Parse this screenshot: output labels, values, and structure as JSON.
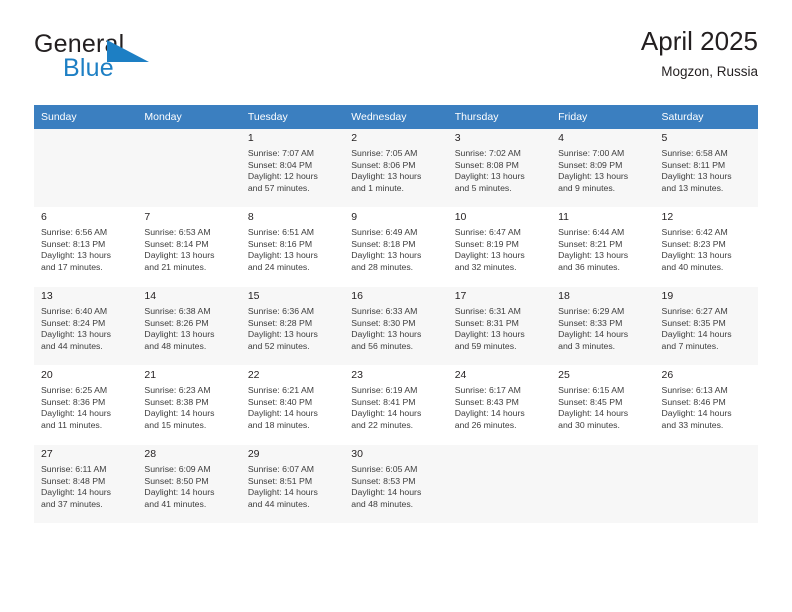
{
  "logo": {
    "word_one": "General",
    "word_two": "Blue",
    "triangle_color": "#1d7fc4",
    "icon": "triangle-flag-icon"
  },
  "header": {
    "title": "April 2025",
    "subtitle": "Mogzon, Russia",
    "accent_color": "#3b7fc0"
  },
  "calendar": {
    "weekdays": [
      "Sunday",
      "Monday",
      "Tuesday",
      "Wednesday",
      "Thursday",
      "Friday",
      "Saturday"
    ],
    "labels": {
      "sunrise": "Sunrise:",
      "sunset": "Sunset:",
      "daylight": "Daylight:"
    },
    "weeks": [
      [
        {
          "day": "",
          "sunrise": "",
          "sunset": "",
          "daylight_line1": "",
          "daylight_line2": ""
        },
        {
          "day": "",
          "sunrise": "",
          "sunset": "",
          "daylight_line1": "",
          "daylight_line2": ""
        },
        {
          "day": "1",
          "sunrise": "Sunrise: 7:07 AM",
          "sunset": "Sunset: 8:04 PM",
          "daylight_line1": "Daylight: 12 hours",
          "daylight_line2": "and 57 minutes."
        },
        {
          "day": "2",
          "sunrise": "Sunrise: 7:05 AM",
          "sunset": "Sunset: 8:06 PM",
          "daylight_line1": "Daylight: 13 hours",
          "daylight_line2": "and 1 minute."
        },
        {
          "day": "3",
          "sunrise": "Sunrise: 7:02 AM",
          "sunset": "Sunset: 8:08 PM",
          "daylight_line1": "Daylight: 13 hours",
          "daylight_line2": "and 5 minutes."
        },
        {
          "day": "4",
          "sunrise": "Sunrise: 7:00 AM",
          "sunset": "Sunset: 8:09 PM",
          "daylight_line1": "Daylight: 13 hours",
          "daylight_line2": "and 9 minutes."
        },
        {
          "day": "5",
          "sunrise": "Sunrise: 6:58 AM",
          "sunset": "Sunset: 8:11 PM",
          "daylight_line1": "Daylight: 13 hours",
          "daylight_line2": "and 13 minutes."
        }
      ],
      [
        {
          "day": "6",
          "sunrise": "Sunrise: 6:56 AM",
          "sunset": "Sunset: 8:13 PM",
          "daylight_line1": "Daylight: 13 hours",
          "daylight_line2": "and 17 minutes."
        },
        {
          "day": "7",
          "sunrise": "Sunrise: 6:53 AM",
          "sunset": "Sunset: 8:14 PM",
          "daylight_line1": "Daylight: 13 hours",
          "daylight_line2": "and 21 minutes."
        },
        {
          "day": "8",
          "sunrise": "Sunrise: 6:51 AM",
          "sunset": "Sunset: 8:16 PM",
          "daylight_line1": "Daylight: 13 hours",
          "daylight_line2": "and 24 minutes."
        },
        {
          "day": "9",
          "sunrise": "Sunrise: 6:49 AM",
          "sunset": "Sunset: 8:18 PM",
          "daylight_line1": "Daylight: 13 hours",
          "daylight_line2": "and 28 minutes."
        },
        {
          "day": "10",
          "sunrise": "Sunrise: 6:47 AM",
          "sunset": "Sunset: 8:19 PM",
          "daylight_line1": "Daylight: 13 hours",
          "daylight_line2": "and 32 minutes."
        },
        {
          "day": "11",
          "sunrise": "Sunrise: 6:44 AM",
          "sunset": "Sunset: 8:21 PM",
          "daylight_line1": "Daylight: 13 hours",
          "daylight_line2": "and 36 minutes."
        },
        {
          "day": "12",
          "sunrise": "Sunrise: 6:42 AM",
          "sunset": "Sunset: 8:23 PM",
          "daylight_line1": "Daylight: 13 hours",
          "daylight_line2": "and 40 minutes."
        }
      ],
      [
        {
          "day": "13",
          "sunrise": "Sunrise: 6:40 AM",
          "sunset": "Sunset: 8:24 PM",
          "daylight_line1": "Daylight: 13 hours",
          "daylight_line2": "and 44 minutes."
        },
        {
          "day": "14",
          "sunrise": "Sunrise: 6:38 AM",
          "sunset": "Sunset: 8:26 PM",
          "daylight_line1": "Daylight: 13 hours",
          "daylight_line2": "and 48 minutes."
        },
        {
          "day": "15",
          "sunrise": "Sunrise: 6:36 AM",
          "sunset": "Sunset: 8:28 PM",
          "daylight_line1": "Daylight: 13 hours",
          "daylight_line2": "and 52 minutes."
        },
        {
          "day": "16",
          "sunrise": "Sunrise: 6:33 AM",
          "sunset": "Sunset: 8:30 PM",
          "daylight_line1": "Daylight: 13 hours",
          "daylight_line2": "and 56 minutes."
        },
        {
          "day": "17",
          "sunrise": "Sunrise: 6:31 AM",
          "sunset": "Sunset: 8:31 PM",
          "daylight_line1": "Daylight: 13 hours",
          "daylight_line2": "and 59 minutes."
        },
        {
          "day": "18",
          "sunrise": "Sunrise: 6:29 AM",
          "sunset": "Sunset: 8:33 PM",
          "daylight_line1": "Daylight: 14 hours",
          "daylight_line2": "and 3 minutes."
        },
        {
          "day": "19",
          "sunrise": "Sunrise: 6:27 AM",
          "sunset": "Sunset: 8:35 PM",
          "daylight_line1": "Daylight: 14 hours",
          "daylight_line2": "and 7 minutes."
        }
      ],
      [
        {
          "day": "20",
          "sunrise": "Sunrise: 6:25 AM",
          "sunset": "Sunset: 8:36 PM",
          "daylight_line1": "Daylight: 14 hours",
          "daylight_line2": "and 11 minutes."
        },
        {
          "day": "21",
          "sunrise": "Sunrise: 6:23 AM",
          "sunset": "Sunset: 8:38 PM",
          "daylight_line1": "Daylight: 14 hours",
          "daylight_line2": "and 15 minutes."
        },
        {
          "day": "22",
          "sunrise": "Sunrise: 6:21 AM",
          "sunset": "Sunset: 8:40 PM",
          "daylight_line1": "Daylight: 14 hours",
          "daylight_line2": "and 18 minutes."
        },
        {
          "day": "23",
          "sunrise": "Sunrise: 6:19 AM",
          "sunset": "Sunset: 8:41 PM",
          "daylight_line1": "Daylight: 14 hours",
          "daylight_line2": "and 22 minutes."
        },
        {
          "day": "24",
          "sunrise": "Sunrise: 6:17 AM",
          "sunset": "Sunset: 8:43 PM",
          "daylight_line1": "Daylight: 14 hours",
          "daylight_line2": "and 26 minutes."
        },
        {
          "day": "25",
          "sunrise": "Sunrise: 6:15 AM",
          "sunset": "Sunset: 8:45 PM",
          "daylight_line1": "Daylight: 14 hours",
          "daylight_line2": "and 30 minutes."
        },
        {
          "day": "26",
          "sunrise": "Sunrise: 6:13 AM",
          "sunset": "Sunset: 8:46 PM",
          "daylight_line1": "Daylight: 14 hours",
          "daylight_line2": "and 33 minutes."
        }
      ],
      [
        {
          "day": "27",
          "sunrise": "Sunrise: 6:11 AM",
          "sunset": "Sunset: 8:48 PM",
          "daylight_line1": "Daylight: 14 hours",
          "daylight_line2": "and 37 minutes."
        },
        {
          "day": "28",
          "sunrise": "Sunrise: 6:09 AM",
          "sunset": "Sunset: 8:50 PM",
          "daylight_line1": "Daylight: 14 hours",
          "daylight_line2": "and 41 minutes."
        },
        {
          "day": "29",
          "sunrise": "Sunrise: 6:07 AM",
          "sunset": "Sunset: 8:51 PM",
          "daylight_line1": "Daylight: 14 hours",
          "daylight_line2": "and 44 minutes."
        },
        {
          "day": "30",
          "sunrise": "Sunrise: 6:05 AM",
          "sunset": "Sunset: 8:53 PM",
          "daylight_line1": "Daylight: 14 hours",
          "daylight_line2": "and 48 minutes."
        },
        {
          "day": "",
          "sunrise": "",
          "sunset": "",
          "daylight_line1": "",
          "daylight_line2": ""
        },
        {
          "day": "",
          "sunrise": "",
          "sunset": "",
          "daylight_line1": "",
          "daylight_line2": ""
        },
        {
          "day": "",
          "sunrise": "",
          "sunset": "",
          "daylight_line1": "",
          "daylight_line2": ""
        }
      ]
    ]
  }
}
